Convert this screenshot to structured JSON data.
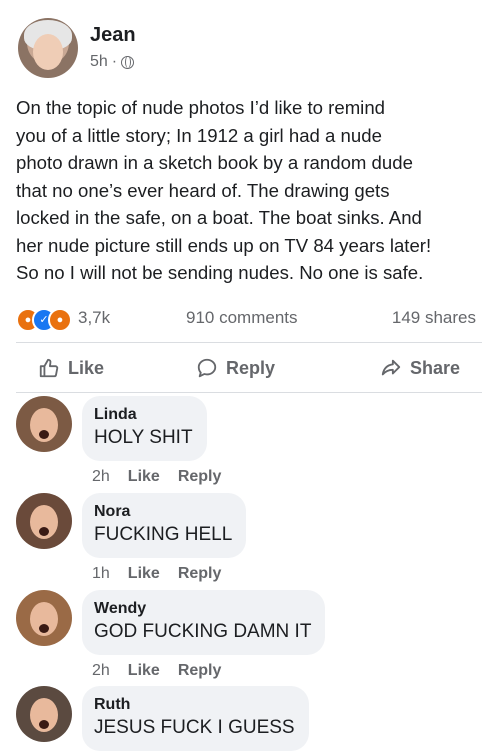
{
  "post": {
    "author": "Jean",
    "time": "5h",
    "separator": "·",
    "privacy_icon": "globe-icon",
    "text_lines": [
      "On the topic of nude photos I’d like to remind",
      "you of a little story; In 1912 a girl had a nude",
      "photo drawn in a sketch book by a random dude",
      "that no one’s ever heard of. The drawing gets",
      "locked in the safe, on a boat. The boat sinks. And",
      "her nude picture still ends up on TV 84 years later!",
      "So no I will not be sending nudes. No one is safe."
    ]
  },
  "stats": {
    "reactions": "3,7k",
    "reaction_icons": [
      "angry-icon",
      "like-icon",
      "angry-icon"
    ],
    "comments": "910 comments",
    "shares": "149 shares"
  },
  "actions": {
    "like": "Like",
    "reply": "Reply",
    "share": "Share"
  },
  "comments": [
    {
      "name": "Linda",
      "text": "HOLY SHIT",
      "time": "2h",
      "like": "Like",
      "reply": "Reply"
    },
    {
      "name": "Nora",
      "text": "FUCKING HELL",
      "time": "1h",
      "like": "Like",
      "reply": "Reply"
    },
    {
      "name": "Wendy",
      "text": "GOD FUCKING DAMN IT",
      "time": "2h",
      "like": "Like",
      "reply": "Reply"
    },
    {
      "name": "Ruth",
      "text": "JESUS FUCK I GUESS"
    }
  ],
  "colors": {
    "link_blue": "#1877f2",
    "angry_orange": "#e9710f",
    "muted": "#65676b",
    "bubble": "#f0f2f5"
  }
}
